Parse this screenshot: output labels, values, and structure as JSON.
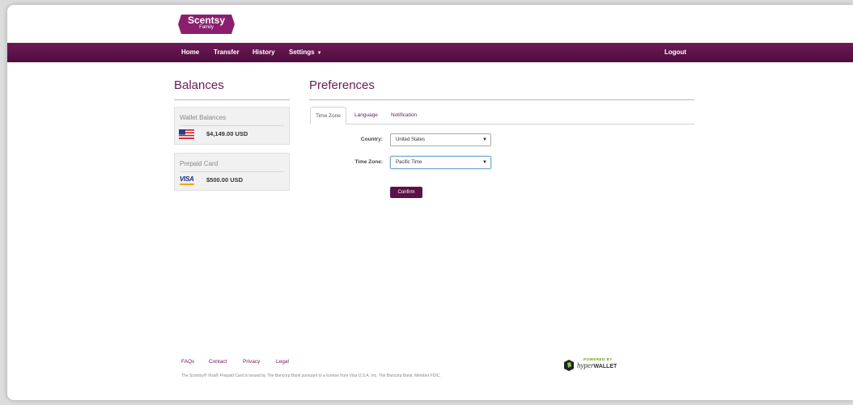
{
  "brand": {
    "name": "Scentsy",
    "sub": "Family",
    "color": "#8b1f6e"
  },
  "nav": {
    "items": [
      "Home",
      "Transfer",
      "History",
      "Settings"
    ],
    "logout": "Logout"
  },
  "balances": {
    "title": "Balances",
    "wallet": {
      "title": "Wallet Balances",
      "amount": "$4,149.00 USD",
      "icon": "us-flag-icon"
    },
    "prepaid": {
      "title": "Prepaid Card",
      "brand": "VISA",
      "amount": "$500.00 USD",
      "icon": "visa-card-icon"
    }
  },
  "preferences": {
    "title": "Preferences",
    "tabs": [
      "Time Zone",
      "Language",
      "Notification"
    ],
    "active_tab": "Time Zone",
    "country": {
      "label": "Country:",
      "value": "United States"
    },
    "timezone": {
      "label": "Time Zone:",
      "value": "Pacific Time"
    },
    "confirm_label": "Confirm"
  },
  "footer": {
    "links": [
      "FAQs",
      "Contact",
      "Privacy",
      "Legal"
    ],
    "note": "The Scentsy® Visa® Prepaid Card is issued by The Bancorp Bank pursuant to a license from Visa U.S.A. Inc. The Bancorp Bank; Member FDIC.",
    "powered_by": "POWERED BY",
    "hyperwallet_a": "hyper",
    "hyperwallet_b": "WALLET"
  },
  "colors": {
    "accent": "#6b1a56",
    "navbar": "#5b1248"
  }
}
